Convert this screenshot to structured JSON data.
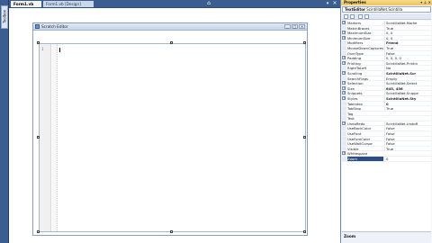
{
  "toolbox": {
    "label": "Toolbox"
  },
  "tabs": [
    {
      "label": "Form1.vb"
    },
    {
      "label": "Form1.vb [Design]"
    }
  ],
  "form": {
    "title": "Scratch Editor",
    "controls": [
      "_",
      "□",
      "×"
    ]
  },
  "editor": {
    "line_number": "1"
  },
  "properties": {
    "title": "Properties",
    "object_name": "TextEditor",
    "object_type": "ScintillaNet.Scintilla",
    "rows": [
      {
        "expand": "+",
        "name": "Markers",
        "value": "ScintillaNet.Marke"
      },
      {
        "expand": "",
        "name": "MatchBraces",
        "value": "True"
      },
      {
        "expand": "+",
        "name": "MaximumSize",
        "value": "0, 0"
      },
      {
        "expand": "+",
        "name": "MinimumSize",
        "value": "0, 0"
      },
      {
        "expand": "",
        "name": "Modifiers",
        "value": "Friend",
        "bold": true
      },
      {
        "expand": "",
        "name": "MouseDownCaptures",
        "value": "True"
      },
      {
        "expand": "",
        "name": "OverType",
        "value": "False"
      },
      {
        "expand": "+",
        "name": "Padding",
        "value": "0, 0, 0, 0"
      },
      {
        "expand": "+",
        "name": "Printing",
        "value": "ScintillaNet.Printin"
      },
      {
        "expand": "",
        "name": "RightToLeft",
        "value": "No"
      },
      {
        "expand": "+",
        "name": "Scrolling",
        "value": "ScintillaNet.Scr",
        "bold": true
      },
      {
        "expand": "",
        "name": "SearchFlags",
        "value": "Empty"
      },
      {
        "expand": "+",
        "name": "Selection",
        "value": "ScintillaNet.Select"
      },
      {
        "expand": "+",
        "name": "Size",
        "value": "645, 456",
        "bold": true
      },
      {
        "expand": "+",
        "name": "Snippets",
        "value": "ScintillaNet.Snippe"
      },
      {
        "expand": "+",
        "name": "Styles",
        "value": "ScintillaNet.Sty",
        "bold": true
      },
      {
        "expand": "",
        "name": "TabIndex",
        "value": "0",
        "bold": true
      },
      {
        "expand": "",
        "name": "TabStop",
        "value": "True"
      },
      {
        "expand": "",
        "name": "Tag",
        "value": ""
      },
      {
        "expand": "",
        "name": "Text",
        "value": ""
      },
      {
        "expand": "+",
        "name": "UndoRedo",
        "value": "ScintillaNet.UndoR"
      },
      {
        "expand": "",
        "name": "UseBackColor",
        "value": "False"
      },
      {
        "expand": "",
        "name": "UseFont",
        "value": "False"
      },
      {
        "expand": "",
        "name": "UseForeColor",
        "value": "False"
      },
      {
        "expand": "",
        "name": "UseWaitCursor",
        "value": "False"
      },
      {
        "expand": "",
        "name": "Visible",
        "value": "True"
      },
      {
        "expand": "+",
        "name": "Whitespace",
        "value": ""
      },
      {
        "expand": "",
        "name": "Zoom",
        "value": "0",
        "selected": true
      }
    ],
    "description_title": "Zoom"
  },
  "colors": {
    "ide_background": "#2f4f7f",
    "panel_header": "#eec35c",
    "selection": "#2c4d85"
  }
}
